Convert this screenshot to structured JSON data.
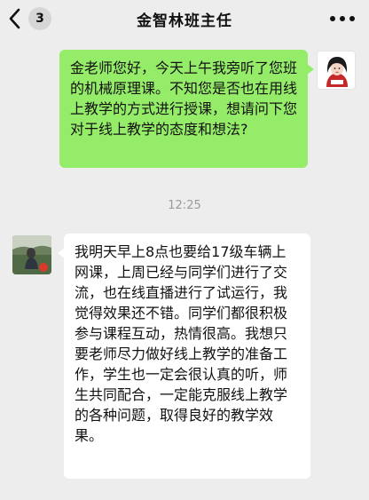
{
  "header": {
    "back_badge": "3",
    "title": "金智林班主任",
    "icons": {
      "back": "chevron-left-icon",
      "more": "more-dots-icon"
    }
  },
  "messages": [
    {
      "direction": "outgoing",
      "text": "金老师您好，今天上午我旁听了您班的机械原理课。不知您是否也在用线上教学的方式进行授课，想请问下您对于线上教学的态度和想法?"
    },
    {
      "direction": "incoming",
      "text": "我明天早上8点也要给17级车辆上网课，上周已经与同学们进行了交流，也在线直播进行了试运行，我觉得效果还不错。同学们都很积极参与课程互动，热情很高。我想只要老师尽力做好线上教学的准备工作，学生也一定会很认真的听，师生共同配合，一定能克服线上教学的各种问题，取得良好的教学效果。"
    }
  ],
  "timestamp": "12:25",
  "colors": {
    "background": "#ededed",
    "outgoing_bubble": "#95ec69",
    "incoming_bubble": "#ffffff",
    "timestamp": "#9a9a9a"
  }
}
